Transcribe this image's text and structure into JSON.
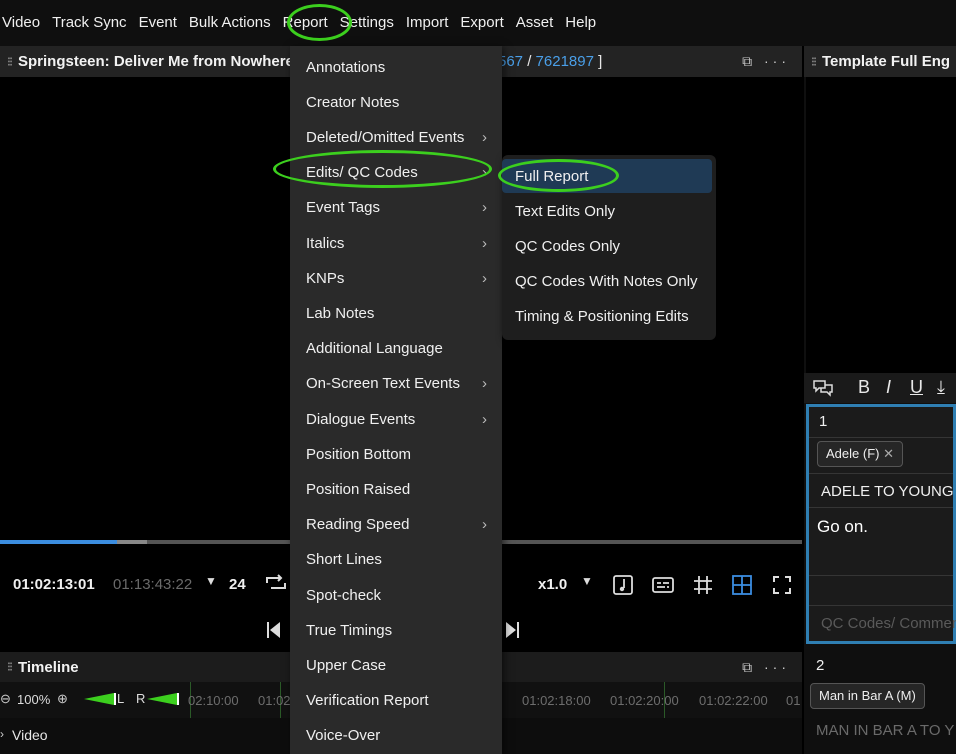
{
  "menubar": {
    "items": [
      "Video",
      "Track Sync",
      "Event",
      "Bulk Actions",
      "Report",
      "Settings",
      "Import",
      "Export",
      "Asset",
      "Help"
    ]
  },
  "video_panel": {
    "title": "Springsteen: Deliver Me from Nowhere",
    "frame_partial": "567",
    "frame_sep": " / ",
    "frame_total": "7621897",
    "frame_close": " ]",
    "timecode": "01:02:13:01",
    "duration": "01:13:43:22",
    "fps": "24",
    "speed": "x1.0",
    "progress_fraction": 0.146
  },
  "timeline": {
    "title": "Timeline",
    "zoom": "100%",
    "meter_left": "L",
    "meter_right": "R",
    "ticks": [
      "02:10:00",
      "01:02",
      "01:02:18:00",
      "01:02:20:00",
      "01:02:22:00",
      "01"
    ],
    "track_label": "Video"
  },
  "report_menu": {
    "items": [
      {
        "label": "Annotations",
        "submenu": false
      },
      {
        "label": "Creator Notes",
        "submenu": false
      },
      {
        "label": "Deleted/Omitted Events",
        "submenu": true
      },
      {
        "label": "Edits/ QC Codes",
        "submenu": true
      },
      {
        "label": "Event Tags",
        "submenu": true
      },
      {
        "label": "Italics",
        "submenu": true
      },
      {
        "label": "KNPs",
        "submenu": true
      },
      {
        "label": "Lab Notes",
        "submenu": false
      },
      {
        "label": "Additional Language",
        "submenu": false
      },
      {
        "label": "On-Screen Text Events",
        "submenu": true
      },
      {
        "label": "Dialogue Events",
        "submenu": true
      },
      {
        "label": "Position Bottom",
        "submenu": false
      },
      {
        "label": "Position Raised",
        "submenu": false
      },
      {
        "label": "Reading Speed",
        "submenu": true
      },
      {
        "label": "Short Lines",
        "submenu": false
      },
      {
        "label": "Spot-check",
        "submenu": false
      },
      {
        "label": "True Timings",
        "submenu": false
      },
      {
        "label": "Upper Case",
        "submenu": false
      },
      {
        "label": "Verification Report",
        "submenu": false
      },
      {
        "label": "Voice-Over",
        "submenu": false
      }
    ]
  },
  "submenu": {
    "items": [
      "Full Report",
      "Text Edits Only",
      "QC Codes Only",
      "QC Codes With Notes Only",
      "Timing & Positioning Edits"
    ]
  },
  "right_panel": {
    "title": "Template Full Eng",
    "event1": {
      "number": "1",
      "tag": "Adele (F)",
      "tag_close": "✕",
      "speaker": "ADELE TO YOUNG B",
      "text": "Go on.",
      "notes_placeholder": "QC Codes/ Commen"
    },
    "event2": {
      "number": "2",
      "tag": "Man in Bar A (M)",
      "speaker": "MAN IN BAR A TO Y"
    }
  },
  "icons": {
    "grip": "⁝⁝",
    "popout": "⧉",
    "more": "···",
    "chevron": "›",
    "caret": "▼"
  },
  "colors": {
    "highlight_ring": "#3ccf1e",
    "accent_blue": "#4a9fe8",
    "panel_border": "#2f7fb3"
  }
}
